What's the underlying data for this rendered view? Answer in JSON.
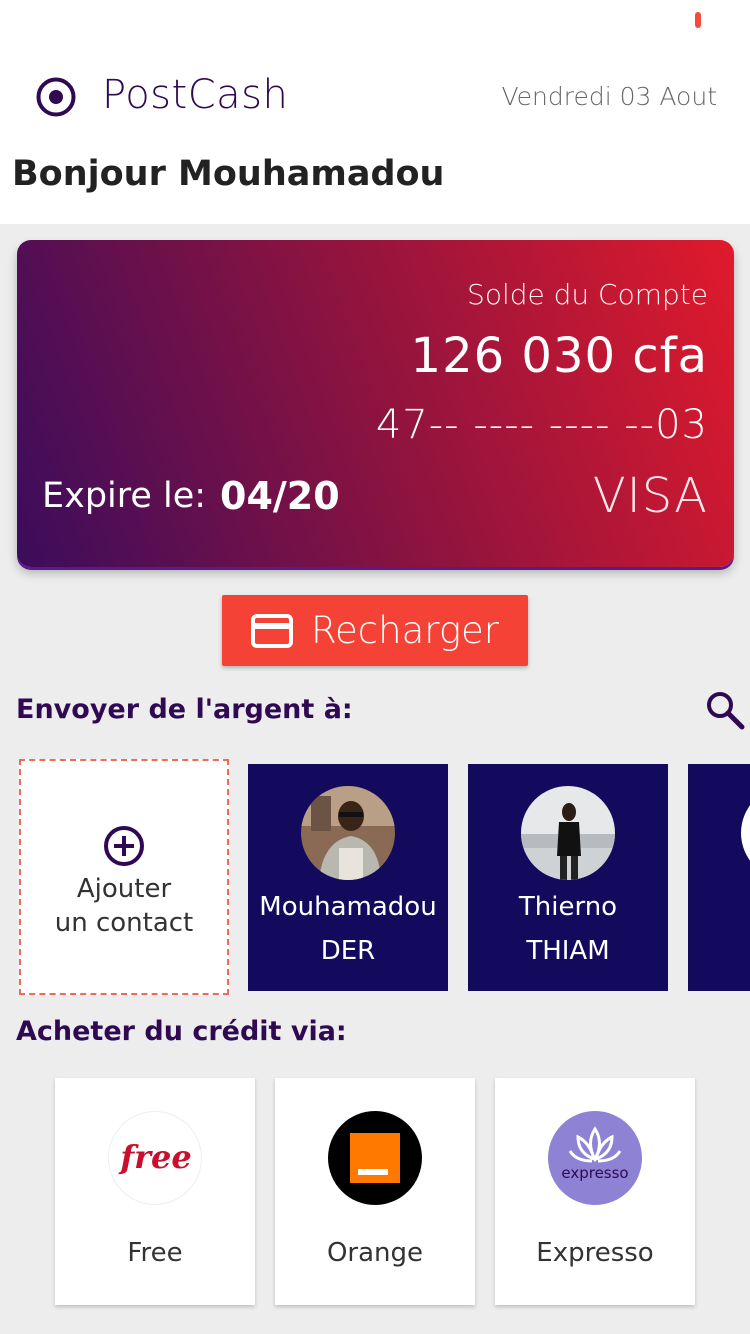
{
  "app": {
    "title": "PostCash",
    "date": "Vendredi 03 Aout",
    "greeting": "Bonjour Mouhamadou"
  },
  "card": {
    "balance_label": "Solde du Compte",
    "balance": "126 030 cfa",
    "number": "47-- ---- ---- --03",
    "expire_label": "Expire le:",
    "expire_value": "04/20",
    "brand": "VISA"
  },
  "recharge": {
    "label": "Recharger",
    "icon": "credit-card-icon"
  },
  "send": {
    "title": "Envoyer de l'argent à:",
    "add_contact": {
      "line1": "Ajouter",
      "line2": "un contact"
    },
    "contacts": [
      {
        "first": "Mouhamadou",
        "last": "DER"
      },
      {
        "first": "Thierno",
        "last": "THIAM"
      }
    ]
  },
  "credit": {
    "title": "Acheter du crédit via:",
    "operators": [
      {
        "label": "Free",
        "logo_text": "free"
      },
      {
        "label": "Orange"
      },
      {
        "label": "Expresso",
        "logo_text": "expresso"
      }
    ]
  },
  "colors": {
    "primary": "#2f0a52",
    "accent": "#f44336",
    "contact_bg": "#130a5e"
  }
}
